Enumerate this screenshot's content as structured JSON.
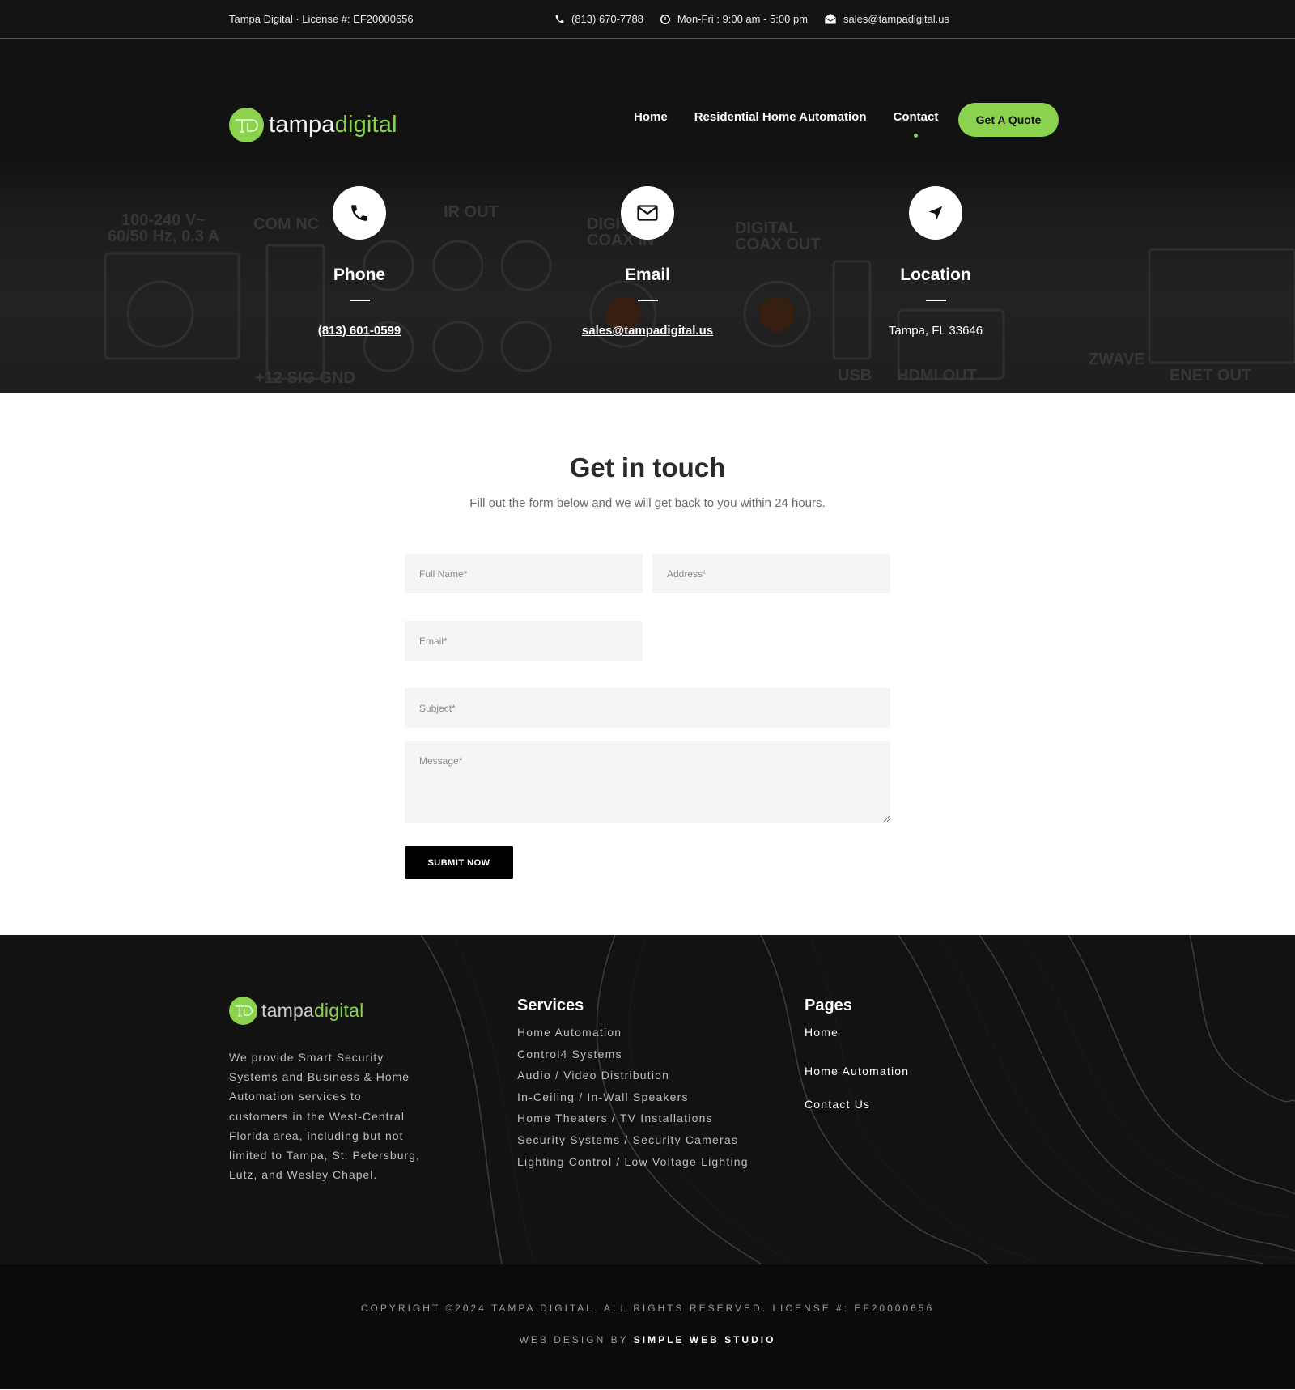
{
  "topbar": {
    "license": "Tampa Digital · License #: EF20000656",
    "phone": "(813) 670-7788",
    "hours": "Mon-Fri : 9:00 am - 5:00 pm",
    "email": "sales@tampadigital.us",
    "icons": {
      "phone": "phone-icon",
      "hours": "clock-icon",
      "email": "envelope-icon"
    }
  },
  "header": {
    "logo": {
      "part1": "tampa",
      "part2": "digital",
      "badge": "TD"
    },
    "nav": [
      {
        "label": "Home",
        "active": false
      },
      {
        "label": "Residential Home Automation",
        "active": false
      },
      {
        "label": "Contact",
        "active": true
      }
    ],
    "cta": "Get A Quote"
  },
  "hero": {
    "cards": [
      {
        "icon": "phone-icon",
        "title": "Phone",
        "value": "(813) 601-0599",
        "link": true
      },
      {
        "icon": "envelope-icon",
        "title": "Email",
        "value": "sales@tampadigital.us",
        "link": true
      },
      {
        "icon": "location-arrow-icon",
        "title": "Location",
        "value": "Tampa, FL 33646",
        "link": false
      }
    ]
  },
  "form": {
    "title": "Get in touch",
    "subtitle": "Fill out the form below and we will get back to you within 24 hours.",
    "fields": {
      "full_name": {
        "placeholder": "Full Name*",
        "value": ""
      },
      "address": {
        "placeholder": "Address*",
        "value": ""
      },
      "email": {
        "placeholder": "Email*",
        "value": ""
      },
      "subject": {
        "placeholder": "Subject*",
        "value": ""
      },
      "message": {
        "placeholder": "Message*",
        "value": ""
      }
    },
    "submit": "SUBMIT NOW"
  },
  "footer": {
    "logo": {
      "part1": "tampa",
      "part2": "digital"
    },
    "about": "We provide Smart Security Systems and Business & Home Automation services to customers in the West-Central Florida area, including but not limited to Tampa, St. Petersburg, Lutz, and Wesley Chapel.",
    "services": {
      "heading": "Services",
      "items": [
        "Home Automation",
        "Control4 Systems",
        "Audio / Video Distribution",
        "In-Ceiling / In-Wall Speakers",
        "Home Theaters / TV Installations",
        "Security Systems / Security Cameras",
        "Lighting Control / Low Voltage Lighting"
      ]
    },
    "pages": {
      "heading": "Pages",
      "items": [
        "Home",
        "Home Automation",
        "Contact Us"
      ]
    }
  },
  "bottom": {
    "copyright": "COPYRIGHT ©2024 TAMPA DIGITAL. ALL RIGHTS RESERVED. LICENSE #: EF20000656",
    "credit_prefix": "WEB DESIGN BY ",
    "credit_name": "SIMPLE WEB STUDIO"
  },
  "colors": {
    "brand_green": "#8bd34e",
    "dark_bg": "#121212",
    "bottom_bg": "#0b0b0b",
    "field_bg": "#f5f5f5"
  }
}
